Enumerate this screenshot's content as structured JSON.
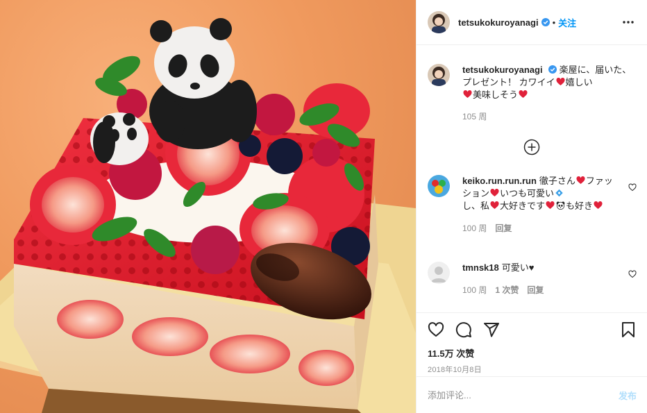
{
  "colors": {
    "accent": "#0095f6",
    "text": "#262626",
    "muted": "#8e8e8e",
    "heart": "#ed4956",
    "post_disabled": "#b2dffc"
  },
  "post": {
    "image_alt": "panda cake"
  },
  "header": {
    "username": "tetsukokuroyanagi",
    "verified_icon": "verified-badge-icon",
    "separator": "•",
    "follow_label": "关注",
    "more_icon": "more-options-icon"
  },
  "caption": {
    "username": "tetsukokuroyanagi",
    "text_1": "楽屋に、届いた、プレゼント！ カワイイ",
    "text_2": "嬉しい",
    "text_3": "美味しそう",
    "age": "105 周"
  },
  "load_more_icon": "plus-circle-icon",
  "comments": [
    {
      "username": "keiko.run.run.run",
      "text_1": "徹子さん",
      "text_2": "ファッション",
      "text_3": "いつも可愛い",
      "text_4": "し、私",
      "text_5": "大好きです",
      "text_6": "も好き",
      "age": "100 周",
      "reply_label": "回复"
    },
    {
      "username": "tmnsk18",
      "text": "可愛い♥",
      "age": "100 周",
      "likes": "1 次赞",
      "reply_label": "回复"
    }
  ],
  "actions": {
    "like_icon": "heart-outline-icon",
    "comment_icon": "comment-icon",
    "share_icon": "share-icon",
    "save_icon": "bookmark-icon",
    "likes_count": "11.5万 次赞",
    "date": "2018年10月8日"
  },
  "add_comment": {
    "placeholder": "添加评论...",
    "post_label": "发布"
  }
}
